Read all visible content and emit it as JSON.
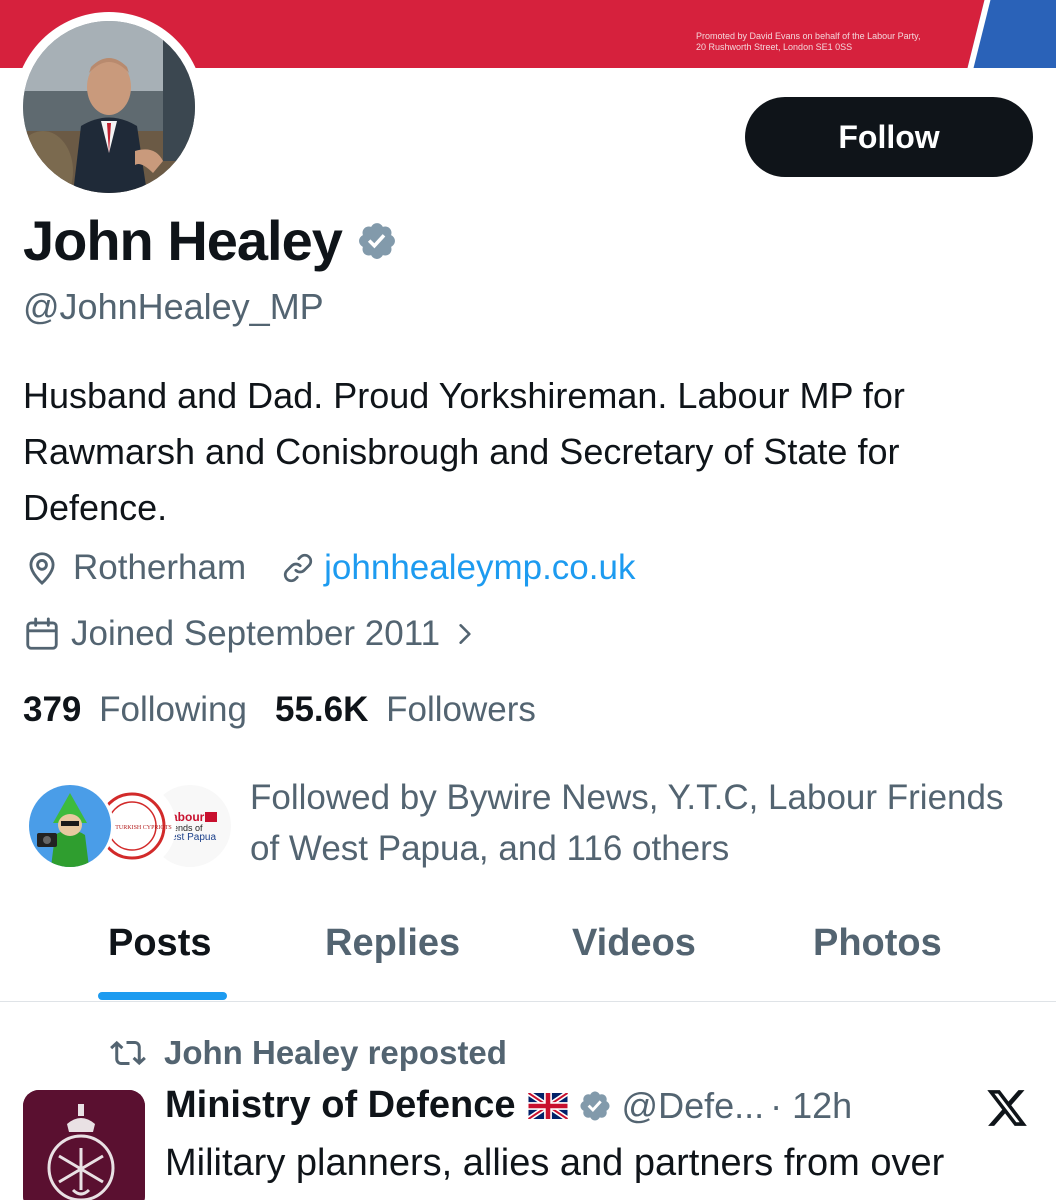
{
  "banner": {
    "imprint_line1": "Promoted by David Evans on behalf of the Labour Party,",
    "imprint_line2": "20 Rushworth Street, London SE1 0SS"
  },
  "profile": {
    "display_name": "John Healey",
    "handle": "@JohnHealey_MP",
    "bio": "Husband and Dad. Proud Yorkshireman. Labour MP for Rawmarsh and Conisbrough and Secretary of State for Defence.",
    "location": "Rotherham",
    "website": "johnhealeymp.co.uk",
    "joined": "Joined September 2011",
    "following_count": "379",
    "following_label": "Following",
    "followers_count": "55.6K",
    "followers_label": "Followers",
    "followed_by": "Followed by Bywire News, Y.T.C, Labour Friends of West Papua, and 116 others"
  },
  "follow_button": {
    "label": "Follow"
  },
  "mini_avatars": {
    "ytc_text": "YOUNG TURKISH CYPRIOTS",
    "lfwp_text_1": "abour",
    "lfwp_text_2": "iends of",
    "lfwp_text_3": "est Papua"
  },
  "tabs": [
    {
      "label": "Posts",
      "active": true
    },
    {
      "label": "Replies",
      "active": false
    },
    {
      "label": "Videos",
      "active": false
    },
    {
      "label": "Photos",
      "active": false
    }
  ],
  "post": {
    "repost_label": "John Healey reposted",
    "author": "Ministry of Defence",
    "handle": "@Defe...",
    "time": "· 12h",
    "text": "Military planners, allies and partners from over"
  },
  "icons": {
    "verified": "verified-badge-icon",
    "location": "location-pin-icon",
    "link": "link-icon",
    "calendar": "calendar-icon",
    "chevron": "chevron-right-icon",
    "repost": "repost-icon",
    "flag": "uk-flag-icon",
    "x": "x-logo-icon"
  },
  "colors": {
    "banner_red": "#d6213d",
    "banner_blue": "#2a62b8",
    "accent": "#1d9bf0",
    "text": "#0f1419",
    "muted": "#536471"
  }
}
